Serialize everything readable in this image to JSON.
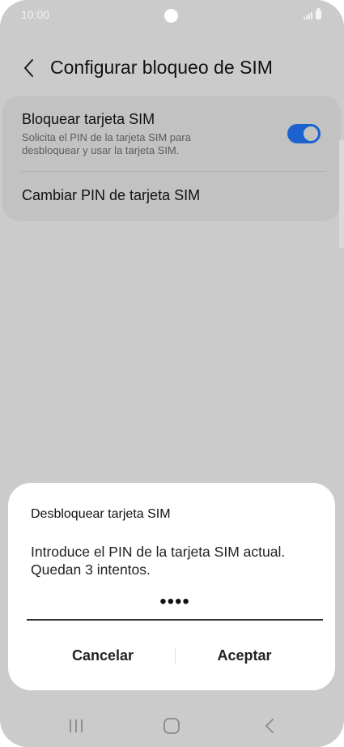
{
  "status_bar": {
    "time": "10:00"
  },
  "header": {
    "back_icon": "chevron-left-icon",
    "title": "Configurar bloqueo de SIM"
  },
  "settings": {
    "lock_sim": {
      "title": "Bloquear tarjeta SIM",
      "description": "Solicita el PIN de la tarjeta SIM para desbloquear y usar la tarjeta SIM.",
      "enabled": true
    },
    "change_pin": {
      "label": "Cambiar PIN de tarjeta SIM"
    }
  },
  "dialog": {
    "title": "Desbloquear tarjeta SIM",
    "message": "Introduce el PIN de la tarjeta SIM actual. Quedan 3 intentos.",
    "pin_value": "••••",
    "cancel_label": "Cancelar",
    "accept_label": "Aceptar"
  },
  "navigation": {
    "recents_icon": "recents-icon",
    "home_icon": "home-icon",
    "back_icon": "back-icon"
  },
  "colors": {
    "accent": "#1c63cf",
    "background": "#cbcbcb",
    "card": "#c2c2c2",
    "dialog": "#ffffff"
  }
}
